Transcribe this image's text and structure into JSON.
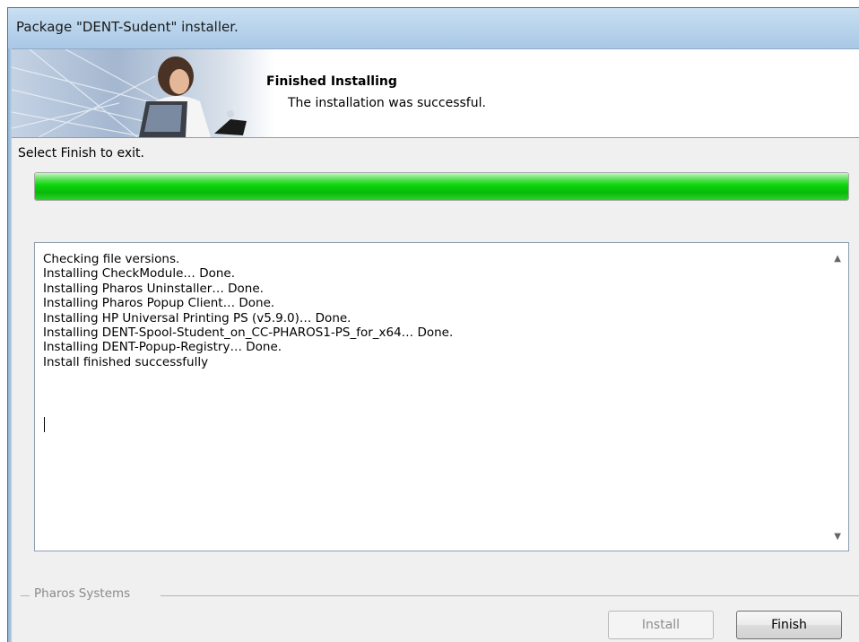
{
  "window": {
    "title": "Package \"DENT-Sudent\" installer."
  },
  "banner": {
    "heading": "Finished Installing",
    "subheading": "The installation was successful."
  },
  "instruction": "Select Finish to exit.",
  "progress": {
    "percent": 100,
    "color": "#0bd60b"
  },
  "log": {
    "lines": [
      "Checking file versions.",
      "Installing CheckModule… Done.",
      "Installing Pharos Uninstaller… Done.",
      "Installing Pharos Popup Client… Done.",
      "Installing HP Universal Printing PS (v5.9.0)… Done.",
      "Installing DENT-Spool-Student_on_CC-PHAROS1-PS_for_x64… Done.",
      "Installing DENT-Popup-Registry… Done.",
      "Install finished successfully"
    ]
  },
  "footer": {
    "group_label": "Pharos Systems",
    "install_label": "Install",
    "finish_label": "Finish"
  }
}
